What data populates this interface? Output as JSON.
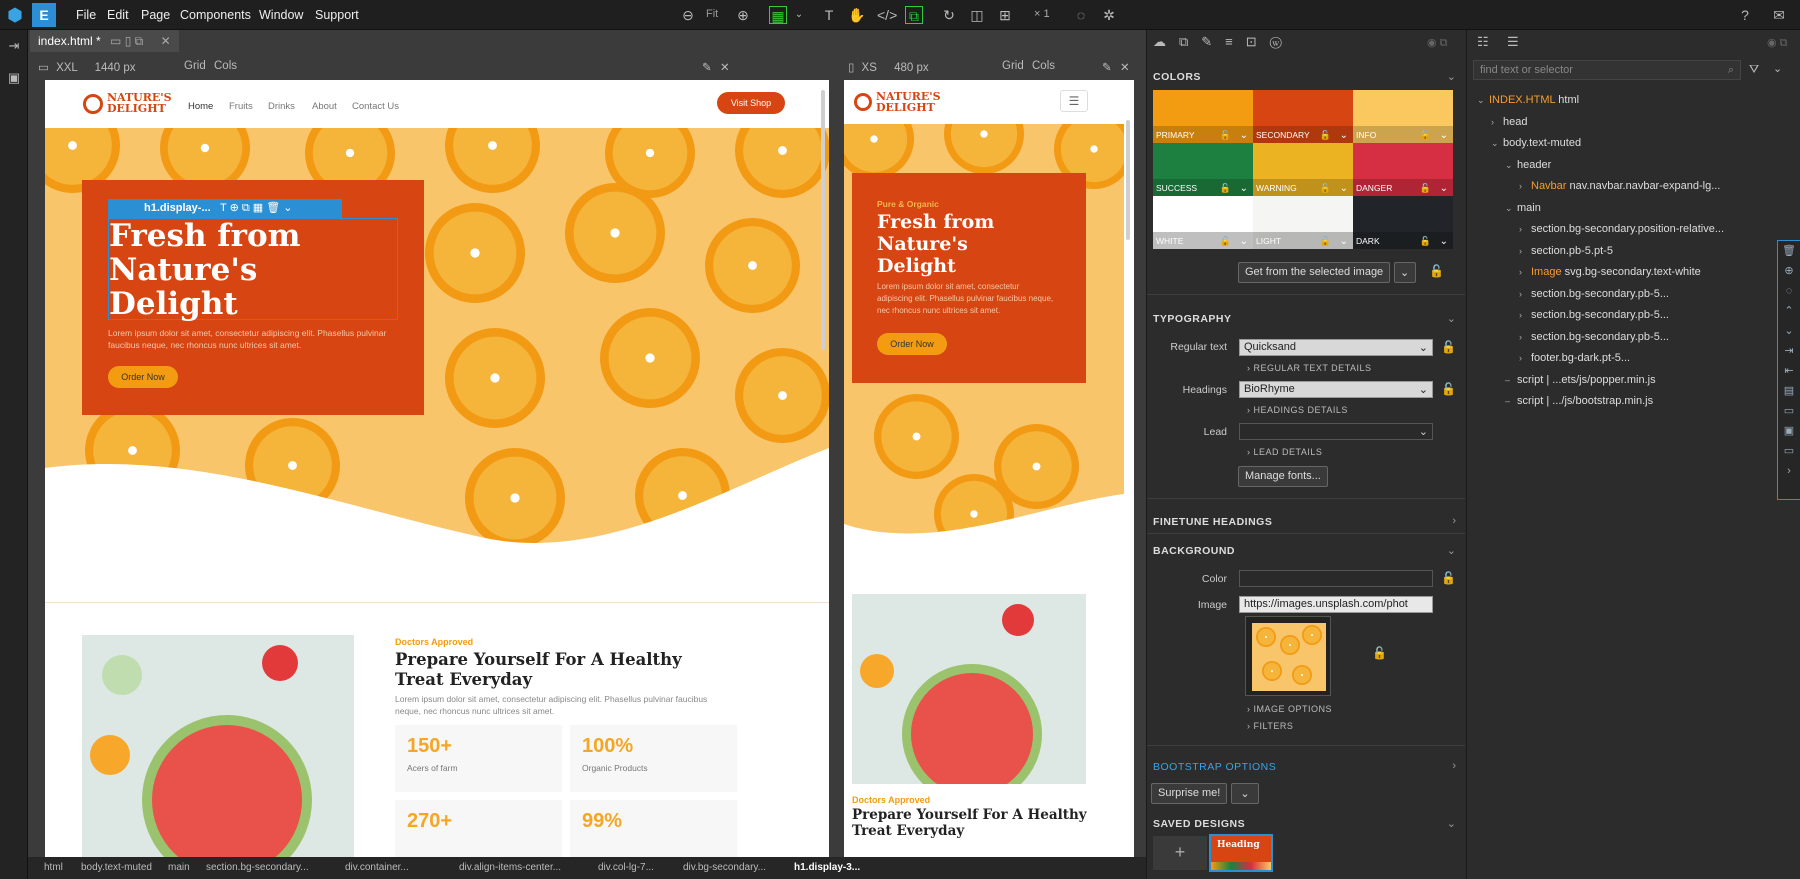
{
  "menubar": {
    "items": [
      "File",
      "Edit",
      "Page",
      "Components",
      "Window",
      "Support"
    ],
    "zoom_label": "Fit",
    "multiplier": "× 1"
  },
  "tab": {
    "title": "index.html *"
  },
  "view_lg": {
    "size": "XXL",
    "width": "1440 px",
    "grid": "Grid",
    "cols": "Cols"
  },
  "view_xs": {
    "size": "XS",
    "width": "480 px",
    "grid": "Grid",
    "cols": "Cols"
  },
  "site": {
    "logo_line1": "NATURE'S",
    "logo_line2": "DELIGHT",
    "nav": [
      "Home",
      "Fruits",
      "Drinks",
      "About",
      "Contact Us"
    ],
    "visit_shop": "Visit Shop",
    "selected_tag": "h1.display-...",
    "hero_title_l1": "Fresh from",
    "hero_title_l2": "Nature's",
    "hero_title_l3": "Delight",
    "hero_text": "Lorem ipsum dolor sit amet, consectetur adipiscing elit. Phasellus pulvinar faucibus neque, nec rhoncus nunc ultrices sit amet.",
    "order_now": "Order Now",
    "pure_organic": "Pure & Organic",
    "doctors": "Doctors Approved",
    "section_title_l1": "Prepare Yourself For A Healthy",
    "section_title_l2": "Treat Everyday",
    "section_text": "Lorem ipsum dolor sit amet, consectetur adipiscing elit. Phasellus pulvinar faucibus neque, nec rhoncus nunc ultrices sit amet.",
    "stats": [
      {
        "num": "150+",
        "label": "Acers of farm"
      },
      {
        "num": "100%",
        "label": "Organic Products"
      },
      {
        "num": "270+",
        "label": ""
      },
      {
        "num": "99%",
        "label": ""
      }
    ]
  },
  "props": {
    "colors_title": "COLORS",
    "swatches": [
      {
        "name": "PRIMARY",
        "color": "#f39c12"
      },
      {
        "name": "SECONDARY",
        "color": "#d64512"
      },
      {
        "name": "INFO",
        "color": "#fbc860"
      },
      {
        "name": "SUCCESS",
        "color": "#1e8040"
      },
      {
        "name": "WARNING",
        "color": "#ebb222"
      },
      {
        "name": "DANGER",
        "color": "#d62e42"
      },
      {
        "name": "WHITE",
        "color": "#ffffff"
      },
      {
        "name": "LIGHT",
        "color": "#f5f5f3"
      },
      {
        "name": "DARK",
        "color": "#212529"
      }
    ],
    "get_from_image": "Get from the selected image",
    "typography_title": "TYPOGRAPHY",
    "regular_text_label": "Regular text",
    "regular_text_value": "Quicksand",
    "regular_details": "REGULAR TEXT DETAILS",
    "headings_label": "Headings",
    "headings_value": "BioRhyme",
    "headings_details": "HEADINGS DETAILS",
    "lead_label": "Lead",
    "lead_details": "LEAD DETAILS",
    "manage_fonts": "Manage fonts...",
    "finetune": "FINETUNE HEADINGS",
    "background_title": "BACKGROUND",
    "color_label": "Color",
    "image_label": "Image",
    "image_url": "https://images.unsplash.com/phot",
    "image_options": "IMAGE OPTIONS",
    "filters": "FILTERS",
    "bootstrap_options": "BOOTSTRAP OPTIONS",
    "surprise": "Surprise me!",
    "saved_designs": "SAVED DESIGNS",
    "saved_thumb_text": "Heading"
  },
  "tree": {
    "search_placeholder": "find text or selector",
    "rows": [
      {
        "indent": 0,
        "arrow": "v",
        "tag": "INDEX.HTML",
        "text": "html"
      },
      {
        "indent": 1,
        "arrow": ">",
        "tag": "",
        "text": "head"
      },
      {
        "indent": 1,
        "arrow": "v",
        "tag": "",
        "text": "body.text-muted"
      },
      {
        "indent": 2,
        "arrow": "v",
        "tag": "",
        "text": "header"
      },
      {
        "indent": 3,
        "arrow": ">",
        "tag": "Navbar",
        "text": "nav.navbar.navbar-expand-lg..."
      },
      {
        "indent": 2,
        "arrow": "v",
        "tag": "",
        "text": "main"
      },
      {
        "indent": 3,
        "arrow": ">",
        "tag": "",
        "text": "section.bg-secondary.position-relative..."
      },
      {
        "indent": 3,
        "arrow": ">",
        "tag": "",
        "text": "section.pb-5.pt-5"
      },
      {
        "indent": 3,
        "arrow": ">",
        "tag": "Image",
        "text": "svg.bg-secondary.text-white"
      },
      {
        "indent": 3,
        "arrow": ">",
        "tag": "",
        "text": "section.bg-secondary.pb-5..."
      },
      {
        "indent": 3,
        "arrow": ">",
        "tag": "",
        "text": "section.bg-secondary.pb-5..."
      },
      {
        "indent": 3,
        "arrow": ">",
        "tag": "",
        "text": "section.bg-secondary.pb-5..."
      },
      {
        "indent": 3,
        "arrow": ">",
        "tag": "",
        "text": "footer.bg-dark.pt-5..."
      },
      {
        "indent": 2,
        "arrow": "–",
        "tag": "",
        "text": "script | ...ets/js/popper.min.js"
      },
      {
        "indent": 2,
        "arrow": "–",
        "tag": "",
        "text": "script | .../js/bootstrap.min.js"
      }
    ]
  },
  "breadcrumb": [
    "html",
    "body.text-muted",
    "main",
    "section.bg-secondary...",
    "div.container...",
    "div.align-items-center...",
    "div.col-lg-7...",
    "div.bg-secondary...",
    "h1.display-3..."
  ]
}
